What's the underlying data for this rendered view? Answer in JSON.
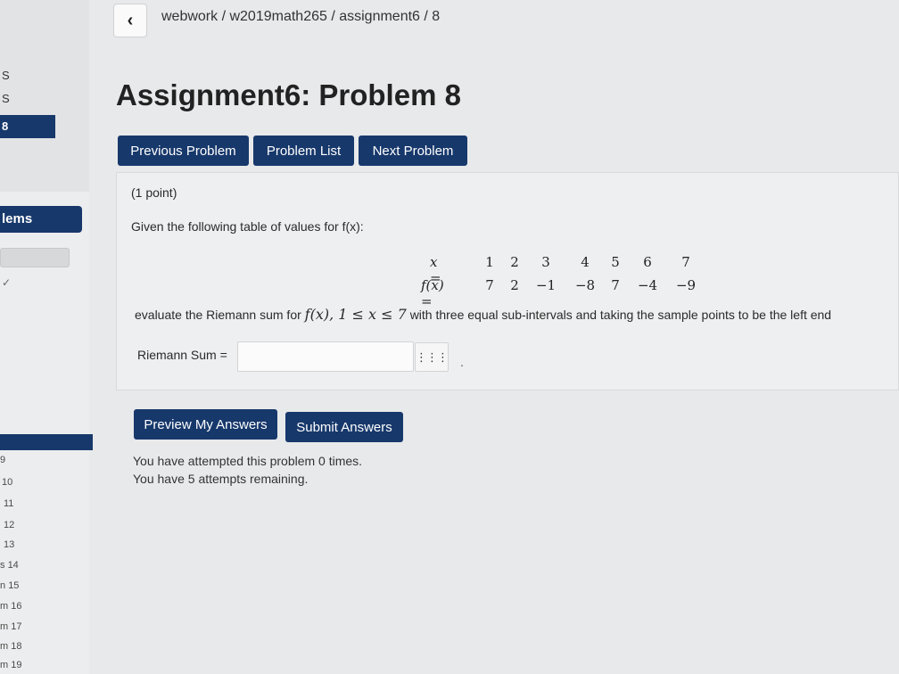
{
  "breadcrumb": "webwork / w2019math265 / assignment6 / 8",
  "back_icon": "‹",
  "title": "Assignment6: Problem 8",
  "nav": {
    "previous": "Previous Problem",
    "list": "Problem List",
    "next": "Next Problem"
  },
  "sidebar": {
    "letters": [
      "S",
      "S"
    ],
    "active_num": "8",
    "problems_label": "lems",
    "check": "✓",
    "numbers": [
      "9",
      "10",
      "11",
      "12",
      "13",
      "14",
      "15",
      "16",
      "17",
      "18",
      "19"
    ],
    "number_prefixes": [
      "",
      "",
      "",
      "",
      "",
      "s",
      "n",
      "m",
      "m",
      "m",
      "m"
    ]
  },
  "problem": {
    "points": "(1 point)",
    "given": "Given the following table of values for f(x):",
    "table": {
      "row1_label": "x =",
      "row2_label": "f(x) =",
      "x": [
        "1",
        "2",
        "3",
        "4",
        "5",
        "6",
        "7"
      ],
      "fx": [
        "7",
        "2",
        "−1",
        "−8",
        "7",
        "−4",
        "−9"
      ]
    },
    "eval_prefix": "evaluate the Riemann sum for",
    "eval_math": "f(x),  1 ≤ x ≤ 7",
    "eval_suffix": "with three equal sub-intervals and taking the sample points to be the left end",
    "answer_label": "Riemann Sum =",
    "answer_value": "",
    "grid_icon": "⋮⋮⋮",
    "dot": "."
  },
  "actions": {
    "preview": "Preview My Answers",
    "submit": "Submit Answers"
  },
  "messages": {
    "attempted": "You have attempted this problem 0 times.",
    "remaining": "You have 5 attempts remaining."
  }
}
